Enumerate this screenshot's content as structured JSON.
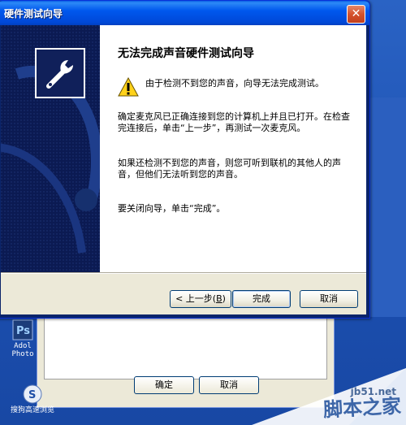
{
  "window": {
    "title": "硬件测试向导",
    "close_glyph": "✕"
  },
  "wizard": {
    "heading": "无法完成声音硬件测试向导",
    "warning_text": "由于检测不到您的声音，向导无法完成测试。",
    "paragraph_mic": "确定麦克风已正确连接到您的计算机上并且已打开。在检查完连接后，单击“上一步”，再测试一次麦克风。",
    "paragraph_hear": "如果还检测不到您的声音，则您可听到联机的其他人的声音，但他们无法听到您的声音。",
    "paragraph_close": "要关闭向导，单击“完成”。"
  },
  "buttons": {
    "back_prefix": "< 上一步(",
    "back_key": "B",
    "back_suffix": ")",
    "finish": "完成",
    "cancel": "取消"
  },
  "background_dialog": {
    "ok": "确定",
    "cancel": "取消"
  },
  "desktop_icons": [
    {
      "label_line1": "Adol",
      "label_line2": "Photo"
    },
    {
      "label_line1": "搜狗高速浏览"
    }
  ],
  "watermark": {
    "url": "jb51.net",
    "text": "脚本之家"
  },
  "colors": {
    "title_blue": "#0058ee",
    "panel_dark": "#0b1a52",
    "face": "#ece9d8",
    "close_red": "#d5522d"
  }
}
